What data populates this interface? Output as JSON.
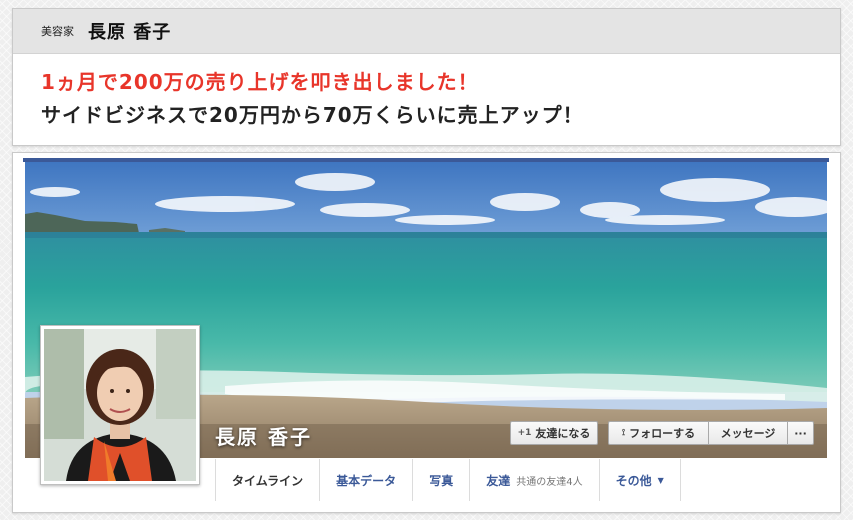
{
  "header": {
    "role": "美容家",
    "name": "長原 香子",
    "headline_red": "1ヵ月で200万の売り上げを叩き出しました！",
    "headline_dark": "サイドビジネスで20万円から70万くらいに売上アップ！"
  },
  "profile": {
    "name": "長原 香子",
    "buttons": {
      "add_friend": "友達になる",
      "add_friend_icon": "add-friend-icon",
      "follow": "フォローする",
      "follow_icon": "rss-icon",
      "message": "メッセージ",
      "more": "···"
    },
    "tabs": [
      {
        "label": "タイムライン",
        "active": true
      },
      {
        "label": "基本データ"
      },
      {
        "label": "写真"
      },
      {
        "label": "友達",
        "sub": "共通の友達4人"
      },
      {
        "label": "その他",
        "caret": "▼"
      }
    ]
  },
  "colors": {
    "accent_blue": "#3b5998",
    "headline_red": "#e8352a"
  }
}
